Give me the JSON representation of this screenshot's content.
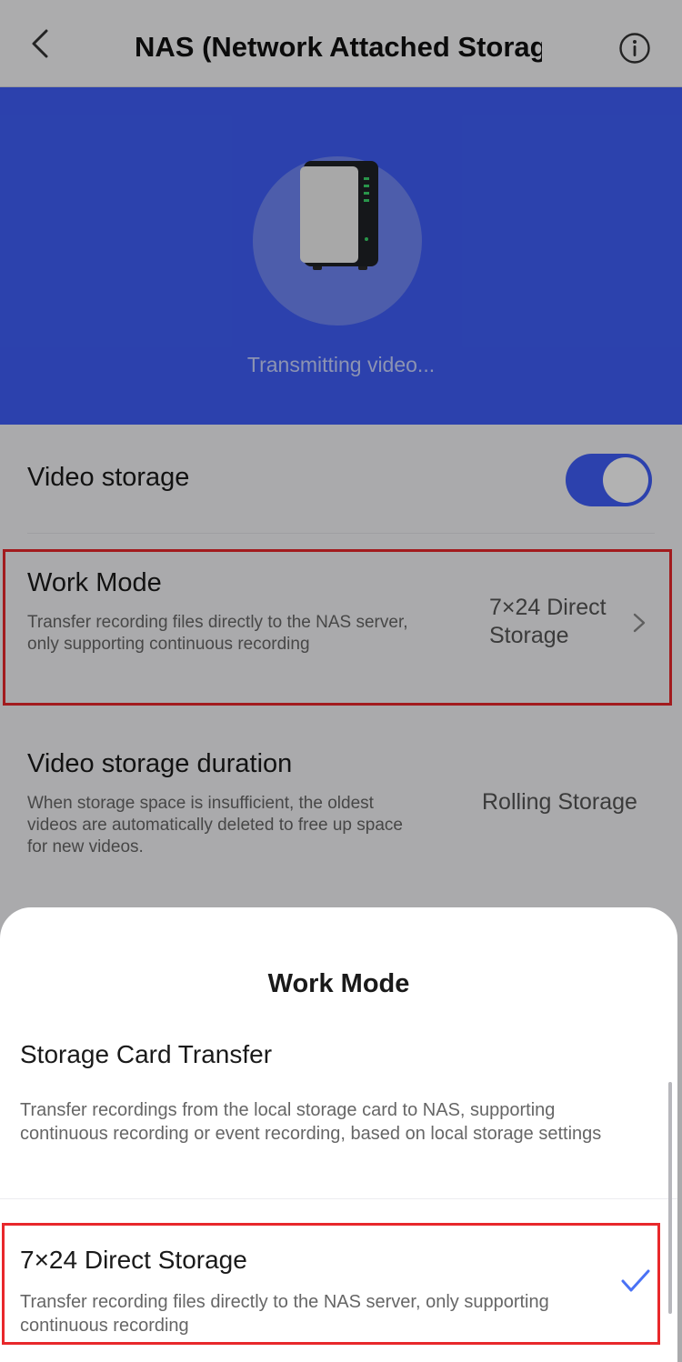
{
  "nav": {
    "title": "NAS (Network Attached Storage)",
    "back_icon": "chevron-left-icon",
    "info_icon": "info-icon"
  },
  "hero": {
    "status": "Transmitting video...",
    "device_icon": "nas-device-icon",
    "bg_color": "#3f5ef8"
  },
  "settings": {
    "video_storage": {
      "label": "Video storage",
      "enabled": true
    },
    "work_mode": {
      "label": "Work Mode",
      "description": "Transfer recording files directly to the NAS server, only supporting continuous recording",
      "value": "7×24 Direct Storage"
    },
    "duration": {
      "label": "Video storage duration",
      "description": "When storage space is insufficient, the oldest videos are automatically deleted to free up space for new videos.",
      "value": "Rolling Storage"
    }
  },
  "sheet": {
    "title": "Work Mode",
    "options": [
      {
        "title": "Storage Card Transfer",
        "description": "Transfer recordings from the local storage card to NAS, supporting continuous recording or event recording, based on local storage settings",
        "selected": false
      },
      {
        "title": "7×24 Direct Storage",
        "description": "Transfer recording files directly to the NAS server, only supporting continuous recording",
        "selected": true
      }
    ]
  },
  "colors": {
    "accent": "#3f5ef8",
    "highlight": "#e8282b"
  }
}
